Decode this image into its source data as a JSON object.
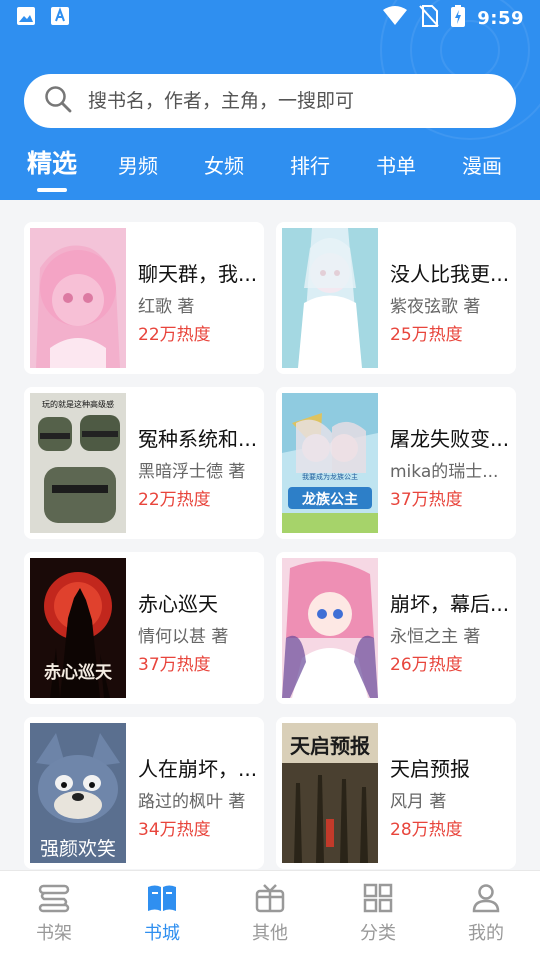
{
  "status_bar": {
    "time": "9:59",
    "left_icons": [
      "image-icon",
      "text-a-icon"
    ],
    "right_icons": [
      "wifi-icon",
      "no-sim-icon",
      "battery-charging-icon"
    ]
  },
  "search": {
    "placeholder": "搜书名，作者，主角，一搜即可",
    "icon": "search-icon"
  },
  "tabs": [
    {
      "label": "精选",
      "active": true
    },
    {
      "label": "男频",
      "active": false
    },
    {
      "label": "女频",
      "active": false
    },
    {
      "label": "排行",
      "active": false
    },
    {
      "label": "书单",
      "active": false
    },
    {
      "label": "漫画",
      "active": false
    }
  ],
  "books": [
    {
      "title": "聊天群，我...",
      "author": "红歌 著",
      "heat": "22万热度"
    },
    {
      "title": "没人比我更...",
      "author": "紫夜弦歌 著",
      "heat": "25万热度"
    },
    {
      "title": "冤种系统和...",
      "author": "黑暗浮士德 著",
      "heat": "22万热度"
    },
    {
      "title": "屠龙失败变...",
      "author": "mika的瑞士...",
      "heat": "37万热度"
    },
    {
      "title": "赤心巡天",
      "author": "情何以甚 著",
      "heat": "37万热度"
    },
    {
      "title": "崩坏，幕后...",
      "author": "永恒之主 著",
      "heat": "26万热度"
    },
    {
      "title": "人在崩坏，...",
      "author": "路过的枫叶 著",
      "heat": "34万热度"
    },
    {
      "title": "天启预报",
      "author": "风月 著",
      "heat": "28万热度"
    }
  ],
  "covers": {
    "c3_text": "玩的就是这种高级感",
    "c4_text": "龙族公主",
    "c4_sub": "我要成为龙族公主",
    "c5_text": "赤心巡天",
    "c7_text": "强颜欢笑",
    "c8_text": "天启预报"
  },
  "bottom_nav": [
    {
      "label": "书架",
      "icon": "bookshelf-icon",
      "active": false
    },
    {
      "label": "书城",
      "icon": "open-book-icon",
      "active": true
    },
    {
      "label": "其他",
      "icon": "gift-icon",
      "active": false
    },
    {
      "label": "分类",
      "icon": "grid-icon",
      "active": false
    },
    {
      "label": "我的",
      "icon": "person-icon",
      "active": false
    }
  ],
  "colors": {
    "brand_blue": "#2f8ff0",
    "heat_red": "#e8453c"
  }
}
